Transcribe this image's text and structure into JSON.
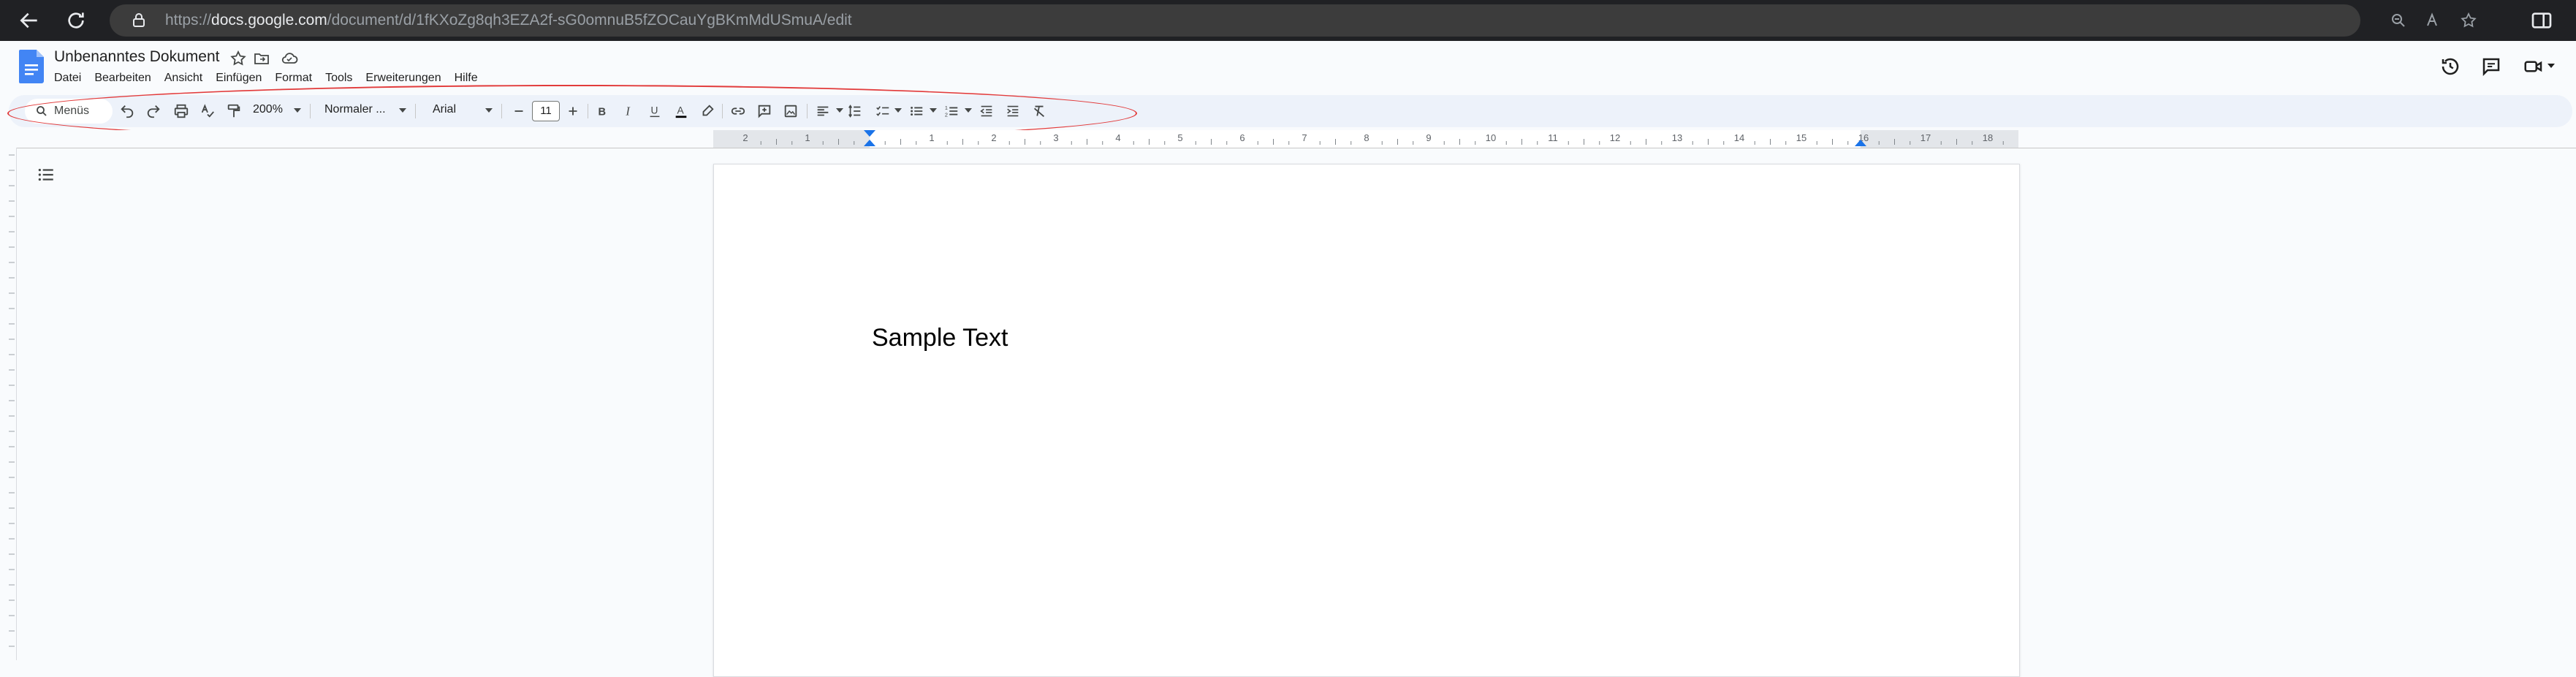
{
  "browser": {
    "url_prefix": "https://",
    "url_domain": "docs.google.com",
    "url_path": "/document/d/1fKXoZg8qh3EZA2f-sG0omnuB5fZOCauYgBKmMdUSmuA/edit"
  },
  "docs": {
    "title": "Unbenanntes Dokument",
    "menu": [
      "Datei",
      "Bearbeiten",
      "Ansicht",
      "Einfügen",
      "Format",
      "Tools",
      "Erweiterungen",
      "Hilfe"
    ]
  },
  "toolbar": {
    "search_label": "Menüs",
    "zoom": "200%",
    "style": "Normaler ...",
    "font": "Arial",
    "font_size": "11"
  },
  "ruler": {
    "labels": [
      "2",
      "1",
      "1",
      "2",
      "3",
      "4",
      "5",
      "6",
      "7",
      "8",
      "9",
      "10",
      "11",
      "12",
      "13",
      "14",
      "15",
      "16",
      "17",
      "18"
    ]
  },
  "document": {
    "text": "Sample Text"
  },
  "colors": {
    "accent": "#1a73e8",
    "annotation": "#e23b3b"
  }
}
